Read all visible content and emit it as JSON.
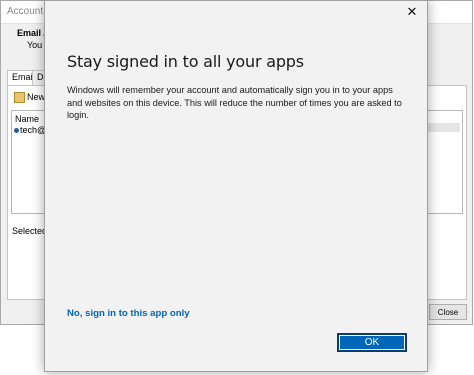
{
  "background_window": {
    "title": "Account Sett",
    "section_title": "Email Acco",
    "section_sub": "You ca",
    "tabs": [
      "Email",
      "Da"
    ],
    "toolbar_new": "New...",
    "list_header": "Name",
    "list_row": "tech@",
    "selected_text": "Selected acc",
    "close_button": "Close"
  },
  "dialog": {
    "close_glyph": "✕",
    "heading": "Stay signed in to all your apps",
    "body": "Windows will remember your account and automatically sign you in to your apps and websites on this device. This will reduce the number of times you are asked to login.",
    "link": "No, sign in to this app only",
    "ok_button": "OK"
  },
  "colors": {
    "accent": "#0067b8",
    "dialog_bg": "#f2f2f2"
  },
  "icons": {
    "close": "close-icon",
    "new": "new-account-icon",
    "status": "default-account-icon"
  }
}
